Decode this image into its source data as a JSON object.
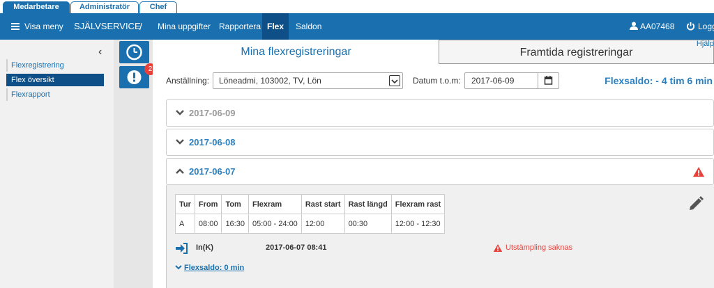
{
  "roles": {
    "medarbetare": "Medarbetare",
    "administrator": "Administratör",
    "chef": "Chef"
  },
  "nav": {
    "menu_label": "Visa meny",
    "brand": "SJÄLVSERVICE",
    "separator": "/",
    "items": [
      "Mina uppgifter",
      "Rapportera",
      "Flex",
      "Saldon"
    ],
    "active_item": "Flex",
    "user_id": "AA07468",
    "logout": "Logg"
  },
  "sidebar": {
    "collapse_icon": "‹",
    "items": [
      "Flexregistrering",
      "Flex översikt",
      "Flexrapport"
    ],
    "active_item": "Flex översikt"
  },
  "icons": {
    "alerts_badge": "2"
  },
  "main": {
    "tabs": [
      "Mina flexregistreringar",
      "Framtida registreringar"
    ],
    "help": "Hjälp",
    "employment_label": "Anställning:",
    "employment_value": "Löneadmi, 103002, TV, Lön",
    "date_label": "Datum t.o.m:",
    "date_value": "2017-06-09",
    "flexsaldo": "Flexsaldo: - 4 tim 6 min"
  },
  "days": [
    {
      "date": "2017-06-09",
      "expanded": false,
      "muted": true
    },
    {
      "date": "2017-06-08",
      "expanded": false,
      "muted": false
    },
    {
      "date": "2017-06-07",
      "expanded": true,
      "muted": false,
      "warning": true
    }
  ],
  "detail": {
    "columns": [
      "Tur",
      "From",
      "Tom",
      "Flexram",
      "Rast start",
      "Rast längd",
      "Flexram rast"
    ],
    "rows": [
      [
        "A",
        "08:00",
        "16:30",
        "05:00 - 24:00",
        "12:00",
        "00:30",
        "12:00 - 12:30"
      ]
    ],
    "stamp_type": "In(K)",
    "stamp_time": "2017-06-07 08:41",
    "warning_text": "Utstämpling saknas",
    "flexsaldo_link": "Flexsaldo: 0 min"
  },
  "colors": {
    "primary": "#1a6fae",
    "active_nav": "#0d4f86",
    "danger": "#e8403a"
  }
}
